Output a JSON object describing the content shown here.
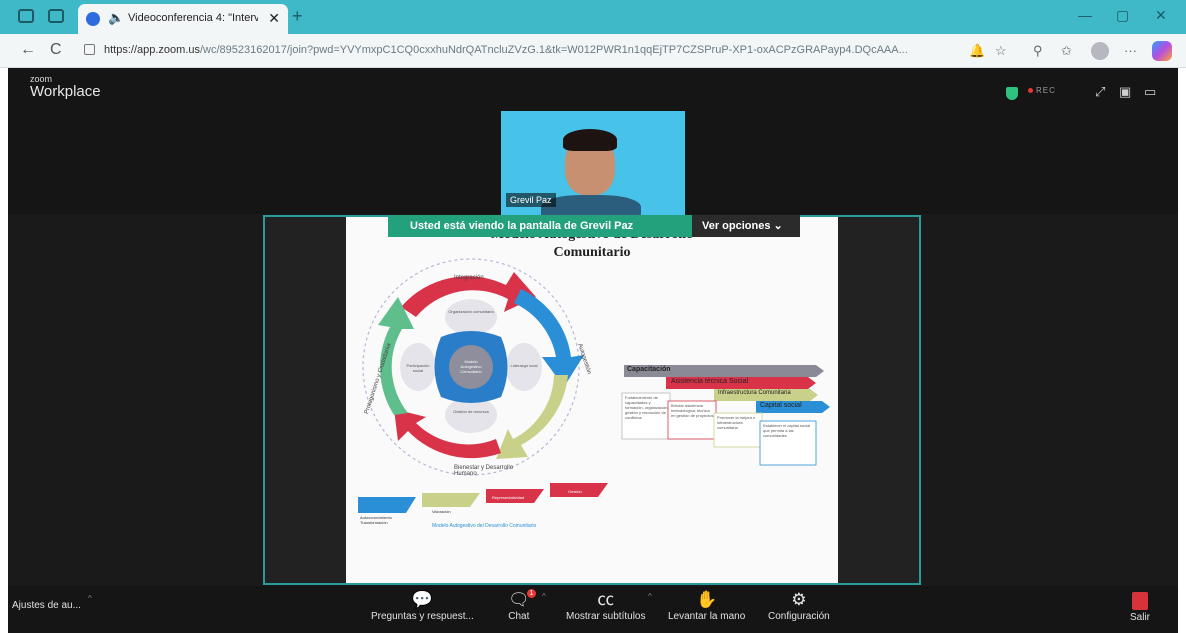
{
  "browser": {
    "tab_title": "Videoconferencia 4: \"Interve",
    "tab_speaker_glyph": "🔈",
    "tab_close": "✕",
    "new_tab": "+",
    "url_host": "https://app.zoom.us",
    "url_path": "/wc/89523162017/join?pwd=YVYmxpC1CQ0cxxhuNdrQATncluZVzG.1&tk=W012PWR1n1qqEjTP7CZSPruP-XP1-oxACPzGRAPayp4.DQcAAA...",
    "reload": "C",
    "back": "←",
    "minimize": "—",
    "maximize": "▢",
    "close": "✕",
    "more": "···"
  },
  "zoom": {
    "brand_small": "zoom",
    "brand": "Workplace",
    "rec": "REC",
    "participant_name": "Grevil Paz",
    "share_banner": "Usted está viendo la pantalla de  Grevil Paz",
    "view_options": "Ver opciones ⌄",
    "bottom_left": "Ajustes de au...",
    "toolbar": {
      "qa": "Preguntas y respuest...",
      "chat": "Chat",
      "chat_badge": "1",
      "captions": "Mostrar subtítulos",
      "raise_hand": "Levantar la mano",
      "settings": "Configuración",
      "leave": "Salir"
    }
  },
  "slide": {
    "title_line1": "Modelo Autogestivo de Desarrollo",
    "title_line2": "Comunitario",
    "cycle_labels": {
      "top": "Integración",
      "right": "Autogestión",
      "bottom": "Bienestar y Desarrollo Humano",
      "left": "Protagonismo y Ciudadanía"
    },
    "center_text": "Modelo Autogestivo Comunitario",
    "petal_texts": [
      "Organización comunitaria",
      "Gestión de recursos",
      "Participación social",
      "Liderazgo local"
    ],
    "ladder": [
      "Capacitación",
      "Asistencia técnica Social",
      "Infraestructura Comunitaria",
      "Capital social"
    ],
    "ladder_boxes": [
      "Fortalecimiento de capacidades y formación, organización, gestión y resolución de conflictos",
      "Brindar asistencia metodológica, técnica en gestión de proyectos",
      "Promover la mejora e infraestructura comunitaria",
      "Establecer el capital social que permita a las comunidades"
    ],
    "legend_items": [
      "Autoconocimiento Transformación",
      "Valoración",
      "Representatividad",
      "Gestión"
    ],
    "legend_caption": "Modelo Autogestivo del Desarrollo Comunitario"
  },
  "colors": {
    "teal_chrome": "#3fb9c8",
    "share_green": "#23a07c",
    "frame_teal": "#2b9a9a",
    "arrow_red": "#d9334a",
    "arrow_blue": "#2a8fd6",
    "arrow_green": "#5fbf8c",
    "arrow_khaki": "#c9d08a"
  }
}
